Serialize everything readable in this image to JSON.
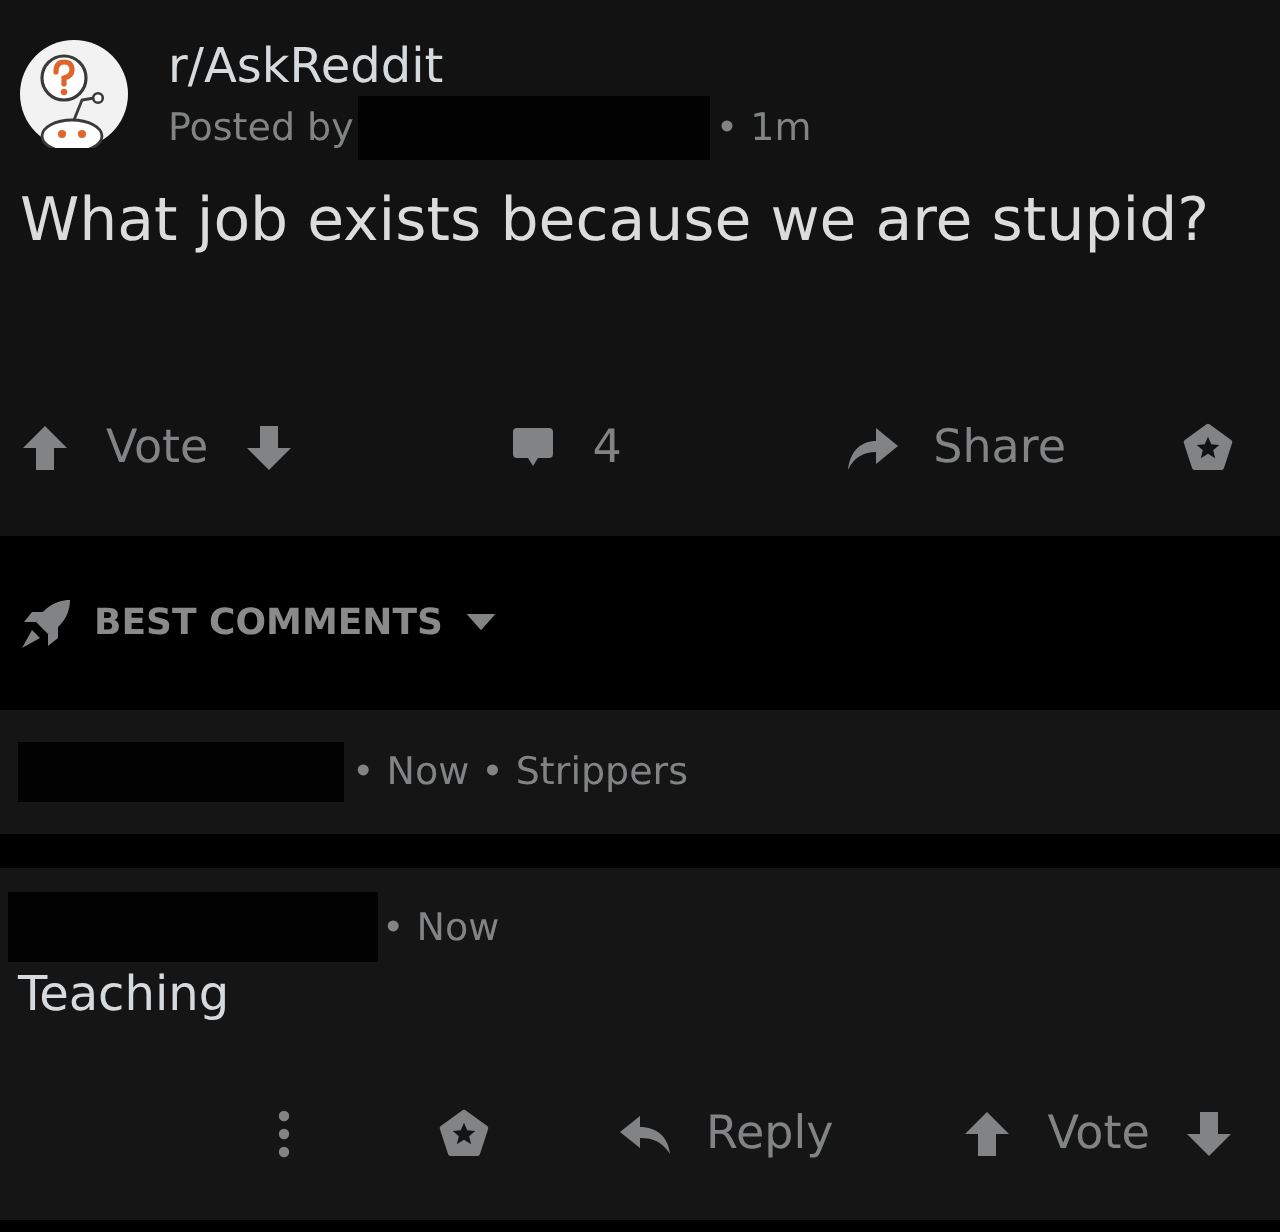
{
  "post": {
    "subreddit": "r/AskReddit",
    "posted_by": "Posted by",
    "age": "• 1m",
    "title": "What job exists because we are stupid?",
    "actions": {
      "vote": "Vote",
      "comment_count": "4",
      "share": "Share"
    }
  },
  "sort": {
    "label": "BEST COMMENTS"
  },
  "comments": [
    {
      "kind": "collapsed",
      "age": "• Now",
      "preview": "• Strippers"
    },
    {
      "kind": "expanded",
      "age": "• Now",
      "body": "Teaching",
      "actions": {
        "reply": "Reply",
        "vote": "Vote"
      }
    }
  ]
}
